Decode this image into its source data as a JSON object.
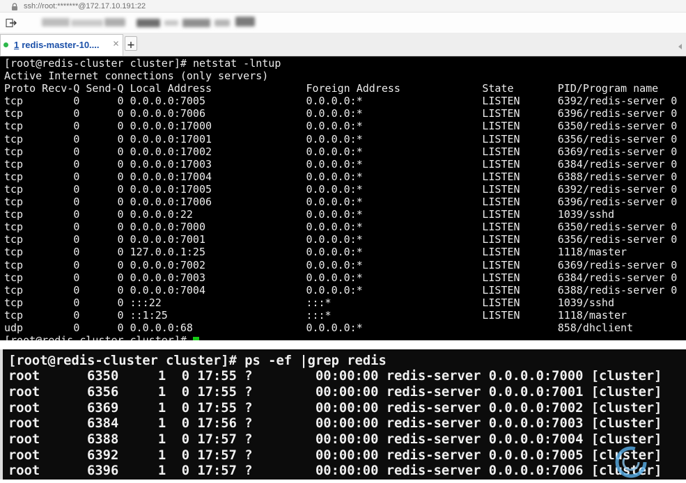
{
  "window": {
    "address": "ssh://root:*******@172.17.10.191:22",
    "icons": {
      "address": "lock-icon",
      "toolbar": "compose-send-icon",
      "tab_close": "close-icon",
      "new_tab": "plus-icon",
      "tab_scroll": "chevron-left-icon",
      "watermark": "watermark-logo"
    }
  },
  "colors": {
    "tab_text": "#1a4fa8",
    "tab_status": "#2db84b",
    "terminal_background": "#000000",
    "terminal_text": "#ececec",
    "cursor": "#16c916"
  },
  "tabs": [
    {
      "index": "1",
      "label": "redis-master-10....",
      "active": true
    }
  ],
  "terminal_netstat": {
    "prompt": "[root@redis-cluster cluster]# ",
    "command": "netstat -lntup",
    "banner": "Active Internet connections (only servers)",
    "columns": [
      "Proto",
      "Recv-Q",
      "Send-Q",
      "Local Address",
      "Foreign Address",
      "State",
      "PID/Program name"
    ],
    "rows": [
      [
        "tcp",
        "0",
        "0",
        "0.0.0.0:7005",
        "0.0.0.0:*",
        "LISTEN",
        "6392/redis-server 0"
      ],
      [
        "tcp",
        "0",
        "0",
        "0.0.0.0:7006",
        "0.0.0.0:*",
        "LISTEN",
        "6396/redis-server 0"
      ],
      [
        "tcp",
        "0",
        "0",
        "0.0.0.0:17000",
        "0.0.0.0:*",
        "LISTEN",
        "6350/redis-server 0"
      ],
      [
        "tcp",
        "0",
        "0",
        "0.0.0.0:17001",
        "0.0.0.0:*",
        "LISTEN",
        "6356/redis-server 0"
      ],
      [
        "tcp",
        "0",
        "0",
        "0.0.0.0:17002",
        "0.0.0.0:*",
        "LISTEN",
        "6369/redis-server 0"
      ],
      [
        "tcp",
        "0",
        "0",
        "0.0.0.0:17003",
        "0.0.0.0:*",
        "LISTEN",
        "6384/redis-server 0"
      ],
      [
        "tcp",
        "0",
        "0",
        "0.0.0.0:17004",
        "0.0.0.0:*",
        "LISTEN",
        "6388/redis-server 0"
      ],
      [
        "tcp",
        "0",
        "0",
        "0.0.0.0:17005",
        "0.0.0.0:*",
        "LISTEN",
        "6392/redis-server 0"
      ],
      [
        "tcp",
        "0",
        "0",
        "0.0.0.0:17006",
        "0.0.0.0:*",
        "LISTEN",
        "6396/redis-server 0"
      ],
      [
        "tcp",
        "0",
        "0",
        "0.0.0.0:22",
        "0.0.0.0:*",
        "LISTEN",
        "1039/sshd"
      ],
      [
        "tcp",
        "0",
        "0",
        "0.0.0.0:7000",
        "0.0.0.0:*",
        "LISTEN",
        "6350/redis-server 0"
      ],
      [
        "tcp",
        "0",
        "0",
        "0.0.0.0:7001",
        "0.0.0.0:*",
        "LISTEN",
        "6356/redis-server 0"
      ],
      [
        "tcp",
        "0",
        "0",
        "127.0.0.1:25",
        "0.0.0.0:*",
        "LISTEN",
        "1118/master"
      ],
      [
        "tcp",
        "0",
        "0",
        "0.0.0.0:7002",
        "0.0.0.0:*",
        "LISTEN",
        "6369/redis-server 0"
      ],
      [
        "tcp",
        "0",
        "0",
        "0.0.0.0:7003",
        "0.0.0.0:*",
        "LISTEN",
        "6384/redis-server 0"
      ],
      [
        "tcp",
        "0",
        "0",
        "0.0.0.0:7004",
        "0.0.0.0:*",
        "LISTEN",
        "6388/redis-server 0"
      ],
      [
        "tcp",
        "0",
        "0",
        ":::22",
        ":::*",
        "LISTEN",
        "1039/sshd"
      ],
      [
        "tcp",
        "0",
        "0",
        "::1:25",
        ":::*",
        "LISTEN",
        "1118/master"
      ],
      [
        "udp",
        "0",
        "0",
        "0.0.0.0:68",
        "0.0.0.0:*",
        "",
        "858/dhclient"
      ]
    ],
    "next_prompt": "[root@redis-cluster cluster]# "
  },
  "terminal_ps": {
    "prompt": "[root@redis-cluster cluster]# ",
    "command": "ps -ef |grep redis",
    "rows": [
      [
        "root",
        "6350",
        "1",
        "0",
        "17:55",
        "?",
        "00:00:00",
        "redis-server 0.0.0.0:7000 [cluster]"
      ],
      [
        "root",
        "6356",
        "1",
        "0",
        "17:55",
        "?",
        "00:00:00",
        "redis-server 0.0.0.0:7001 [cluster]"
      ],
      [
        "root",
        "6369",
        "1",
        "0",
        "17:55",
        "?",
        "00:00:00",
        "redis-server 0.0.0.0:7002 [cluster]"
      ],
      [
        "root",
        "6384",
        "1",
        "0",
        "17:56",
        "?",
        "00:00:00",
        "redis-server 0.0.0.0:7003 [cluster]"
      ],
      [
        "root",
        "6388",
        "1",
        "0",
        "17:57",
        "?",
        "00:00:00",
        "redis-server 0.0.0.0:7004 [cluster]"
      ],
      [
        "root",
        "6392",
        "1",
        "0",
        "17:57",
        "?",
        "00:00:00",
        "redis-server 0.0.0.0:7005 [cluster]"
      ],
      [
        "root",
        "6396",
        "1",
        "0",
        "17:57",
        "?",
        "00:00:00",
        "redis-server 0.0.0.0:7006 [cluster]"
      ]
    ]
  }
}
